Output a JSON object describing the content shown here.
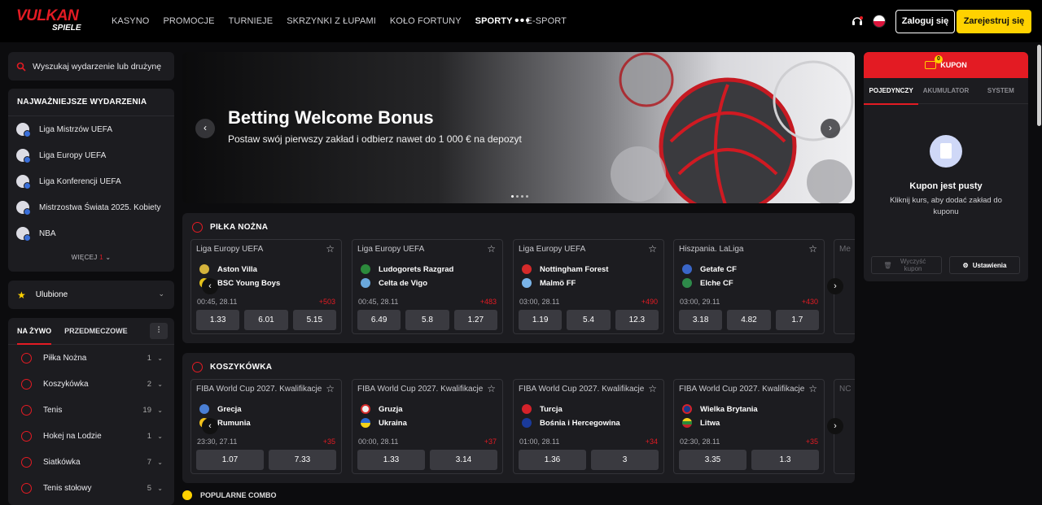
{
  "header": {
    "logo_main": "VULKAN",
    "logo_sub": "SPIELE",
    "nav": [
      "KASYNO",
      "PROMOCJE",
      "TURNIEJE",
      "SKRZYNKI Z ŁUPAMI",
      "KOŁO FORTUNY",
      "SPORTY",
      "E-SPORT"
    ],
    "more": "•••",
    "login": "Zaloguj się",
    "register": "Zarejestruj się"
  },
  "sidebar": {
    "search_placeholder": "Wyszukaj wydarzenie lub drużynę",
    "top_title": "NAJWAŻNIEJSZE WYDARZENIA",
    "top_events": [
      "Liga Mistrzów UEFA",
      "Liga Europy UEFA",
      "Liga Konferencji UEFA",
      "Mistrzostwa Świata 2025. Kobiety",
      "NBA"
    ],
    "more": "WIĘCEJ",
    "more_count": "1",
    "favorites": "Ulubione",
    "tab_live": "NA ŻYWO",
    "tab_prematch": "PRZEDMECZOWE",
    "sports": [
      {
        "name": "Piłka Nożna",
        "count": "1"
      },
      {
        "name": "Koszykówka",
        "count": "2"
      },
      {
        "name": "Tenis",
        "count": "19"
      },
      {
        "name": "Hokej na Lodzie",
        "count": "1"
      },
      {
        "name": "Siatkówka",
        "count": "7"
      },
      {
        "name": "Tenis stołowy",
        "count": "5"
      }
    ]
  },
  "banner": {
    "title": "Betting Welcome Bonus",
    "subtitle": "Postaw swój pierwszy zakład i odbierz nawet do 1 000 € na depozyt"
  },
  "football": {
    "title": "PIŁKA NOŻNA",
    "cards": [
      {
        "league": "Liga Europy UEFA",
        "home": "Aston Villa",
        "away": "BSC Young Boys",
        "time": "00:45, 28.11",
        "more": "+503",
        "odds": [
          "1.33",
          "6.01",
          "5.15"
        ]
      },
      {
        "league": "Liga Europy UEFA",
        "home": "Ludogorets Razgrad",
        "away": "Celta de Vigo",
        "time": "00:45, 28.11",
        "more": "+483",
        "odds": [
          "6.49",
          "5.8",
          "1.27"
        ]
      },
      {
        "league": "Liga Europy UEFA",
        "home": "Nottingham Forest",
        "away": "Malmö FF",
        "time": "03:00, 28.11",
        "more": "+490",
        "odds": [
          "1.19",
          "5.4",
          "12.3"
        ]
      },
      {
        "league": "Hiszpania. LaLiga",
        "home": "Getafe CF",
        "away": "Elche CF",
        "time": "03:00, 29.11",
        "more": "+430",
        "odds": [
          "3.18",
          "4.82",
          "1.7"
        ]
      }
    ],
    "partial": "Me"
  },
  "basketball": {
    "title": "KOSZYKÓWKA",
    "cards": [
      {
        "league": "FIBA World Cup 2027. Kwalifikacje",
        "home": "Grecja",
        "away": "Rumunia",
        "time": "23:30, 27.11",
        "more": "+35",
        "odds": [
          "1.07",
          "7.33"
        ]
      },
      {
        "league": "FIBA World Cup 2027. Kwalifikacje",
        "home": "Gruzja",
        "away": "Ukraina",
        "time": "00:00, 28.11",
        "more": "+37",
        "odds": [
          "1.33",
          "3.14"
        ]
      },
      {
        "league": "FIBA World Cup 2027. Kwalifikacje",
        "home": "Turcja",
        "away": "Bośnia i Hercegowina",
        "time": "01:00, 28.11",
        "more": "+34",
        "odds": [
          "1.36",
          "3"
        ]
      },
      {
        "league": "FIBA World Cup 2027. Kwalifikacje",
        "home": "Wielka Brytania",
        "away": "Litwa",
        "time": "02:30, 28.11",
        "more": "+35",
        "odds": [
          "3.35",
          "1.3"
        ]
      }
    ],
    "partial": "NC"
  },
  "next_section": "POPULARNE COMBO",
  "coupon": {
    "title": "KUPON",
    "badge": "0",
    "tabs": [
      "POJEDYNCZY",
      "AKUMULATOR",
      "SYSTEM"
    ],
    "empty_title": "Kupon jest pusty",
    "empty_sub": "Kliknij kurs, aby dodać zakład do kuponu",
    "clear": "Wyczyść kupon",
    "settings": "Ustawienia"
  },
  "colors": {
    "accent": "#e31b23",
    "yellow": "#ffd200",
    "panel": "#1c1c20"
  }
}
